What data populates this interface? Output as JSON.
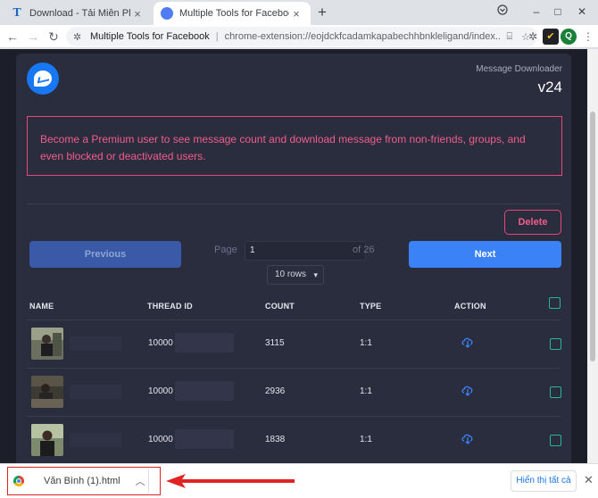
{
  "tabs": [
    {
      "title": "Download - Tải Miễn Phí VN - Ph",
      "icon": "T",
      "active": false
    },
    {
      "title": "Multiple Tools for Facebook by L",
      "icon": "ext",
      "active": true
    }
  ],
  "window": {
    "new_tab": "+",
    "minimize": "–",
    "maximize": "□",
    "close": "✕",
    "tab_close": "×"
  },
  "toolbar": {
    "back": "←",
    "forward": "→",
    "reload": "↻",
    "origin": "Multiple Tools for Facebook",
    "url": "chrome-extension://eojdckfcadamkapabechhbnkleligand/index....",
    "profile_initial": "Q",
    "menu": "⋮"
  },
  "header": {
    "subtitle": "Message Downloader",
    "version": "v24"
  },
  "premium_notice": "Become a Premium user to see message count and download message from non-friends, groups, and even blocked or deactivated users.",
  "controls": {
    "delete_label": "Delete",
    "previous_label": "Previous",
    "next_label": "Next",
    "page_label": "Page",
    "page_value": "1",
    "of_label": "of 26",
    "rows_label": "10 rows"
  },
  "table": {
    "headers": [
      "NAME",
      "THREAD ID",
      "COUNT",
      "TYPE",
      "ACTION"
    ],
    "rows": [
      {
        "thread_prefix": "10000",
        "count": "3115",
        "type": "1:1"
      },
      {
        "thread_prefix": "10000",
        "count": "2936",
        "type": "1:1"
      },
      {
        "thread_prefix": "10000",
        "count": "1838",
        "type": "1:1"
      }
    ]
  },
  "download_bar": {
    "file_name": "Văn Bình (1).html",
    "chevron": "︿",
    "show_all_label": "Hiển thị tất cả",
    "close": "✕"
  },
  "colors": {
    "page_bg": "#1c1e2a",
    "card_bg": "#2a2d3e",
    "accent_blue": "#3b82f6",
    "pink": "#e8457a",
    "teal": "#26b69a",
    "annotation_red": "#e02424"
  }
}
